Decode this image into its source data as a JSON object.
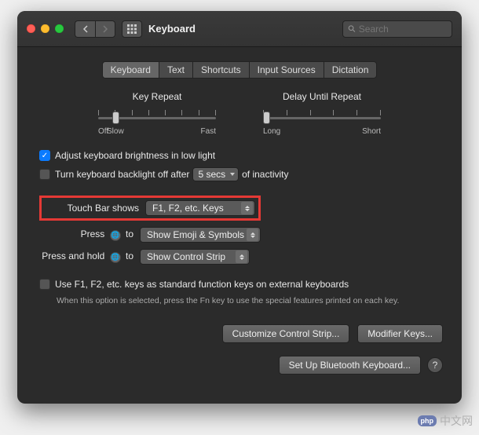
{
  "window": {
    "title": "Keyboard"
  },
  "search": {
    "placeholder": "Search"
  },
  "tabs": [
    "Keyboard",
    "Text",
    "Shortcuts",
    "Input Sources",
    "Dictation"
  ],
  "sliders": {
    "key_repeat": {
      "title": "Key Repeat",
      "left": "Off",
      "left2": "Slow",
      "right": "Fast"
    },
    "delay": {
      "title": "Delay Until Repeat",
      "left": "Long",
      "right": "Short"
    }
  },
  "fields": {
    "brightness": "Adjust keyboard brightness in low light",
    "backlight_off": "Turn keyboard backlight off after",
    "backlight_value": "5 secs",
    "backlight_suffix": "of inactivity",
    "touchbar_label": "Touch Bar shows",
    "touchbar_value": "F1, F2, etc. Keys",
    "press_label_pre": "Press",
    "press_label_post": "to",
    "press_value": "Show Emoji & Symbols",
    "hold_label_pre": "Press and hold",
    "hold_label_post": "to",
    "hold_value": "Show Control Strip",
    "fn_label": "Use F1, F2, etc. keys as standard function keys on external keyboards",
    "fn_help": "When this option is selected, press the Fn key to use the special features printed on each key."
  },
  "buttons": {
    "customize": "Customize Control Strip...",
    "modifier": "Modifier Keys...",
    "bluetooth": "Set Up Bluetooth Keyboard..."
  },
  "watermark": {
    "logo": "php",
    "text": "中文网"
  }
}
